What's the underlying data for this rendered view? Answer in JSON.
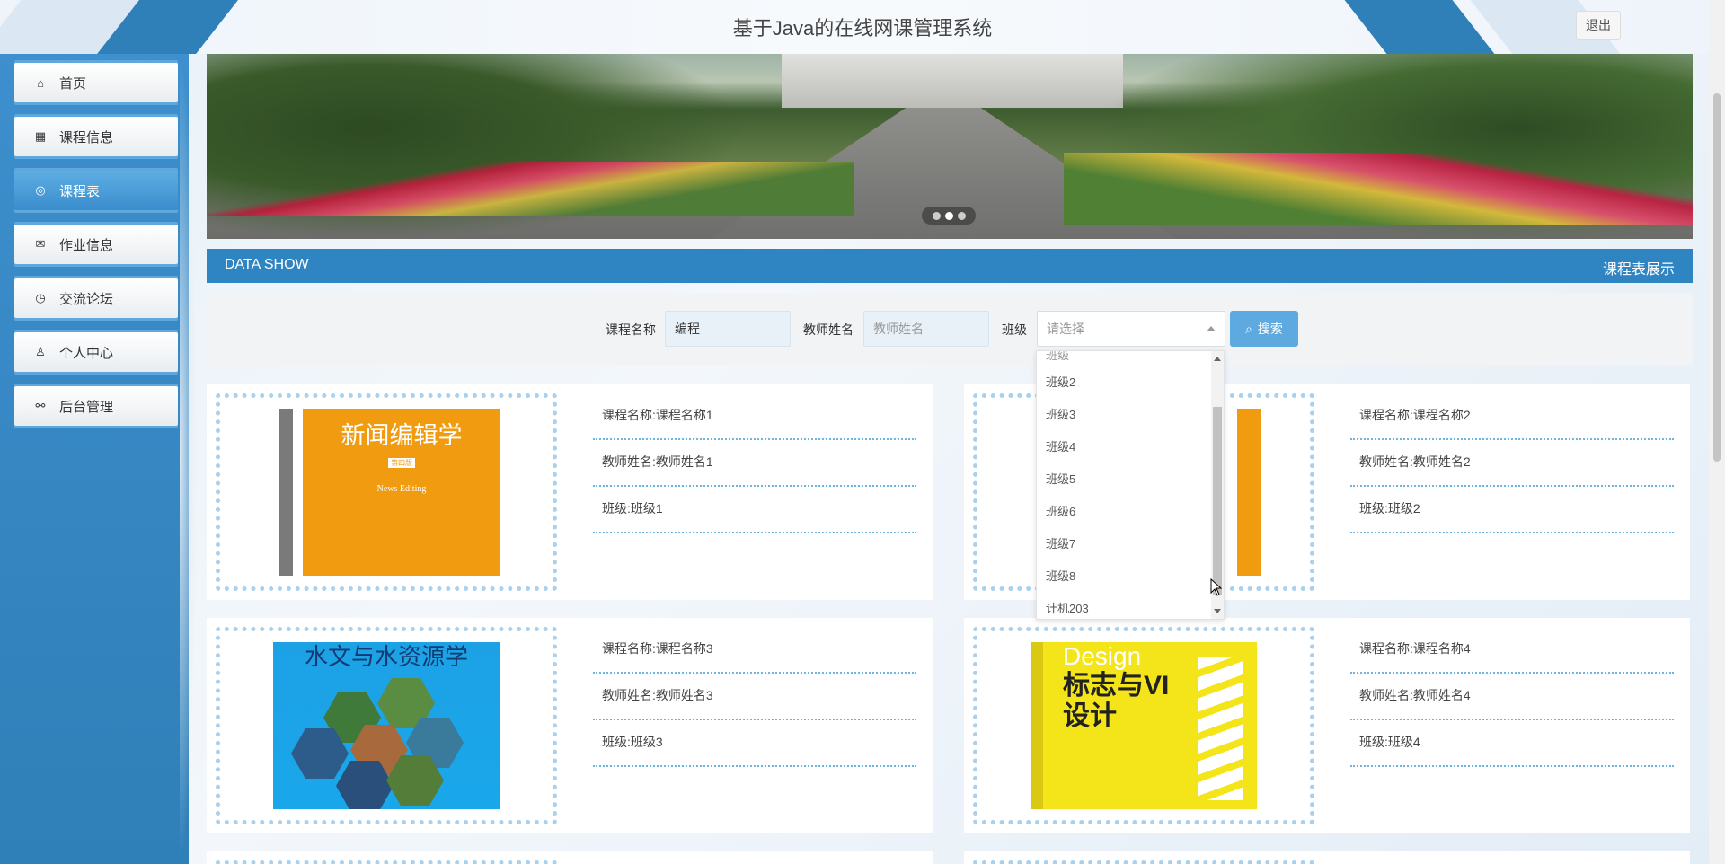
{
  "header": {
    "title": "基于Java的在线网课管理系统",
    "logout_label": "退出"
  },
  "sidebar": {
    "items": [
      {
        "label": "首页",
        "icon": "home-icon"
      },
      {
        "label": "课程信息",
        "icon": "book-icon"
      },
      {
        "label": "课程表",
        "icon": "calendar-icon",
        "active": true
      },
      {
        "label": "作业信息",
        "icon": "mail-icon"
      },
      {
        "label": "交流论坛",
        "icon": "clock-icon"
      },
      {
        "label": "个人中心",
        "icon": "user-icon"
      },
      {
        "label": "后台管理",
        "icon": "link-icon"
      }
    ]
  },
  "banner": {
    "slides": 3,
    "active_slide": 2
  },
  "section": {
    "left_title": "DATA SHOW",
    "right_title": "课程表展示"
  },
  "search": {
    "course_label": "课程名称",
    "course_value": "编程",
    "teacher_label": "教师姓名",
    "teacher_placeholder": "教师姓名",
    "class_label": "班级",
    "class_placeholder": "请选择",
    "button_label": "搜索"
  },
  "dropdown": {
    "options": [
      "班级2",
      "班级3",
      "班级4",
      "班级5",
      "班级6",
      "班级7",
      "班级8",
      "计机203"
    ]
  },
  "cards": [
    {
      "course": "课程名称:课程名称1",
      "teacher": "教师姓名:教师姓名1",
      "class": "班级:班级1",
      "cover_title": "新闻编辑学",
      "cover_subtitle": "News Editing",
      "cover_edition": "第四版"
    },
    {
      "course": "课程名称:课程名称2",
      "teacher": "教师姓名:教师姓名2",
      "class": "班级:班级2"
    },
    {
      "course": "课程名称:课程名称3",
      "teacher": "教师姓名:教师姓名3",
      "class": "班级:班级3",
      "cover_title": "水文与水资源学"
    },
    {
      "course": "课程名称:课程名称4",
      "teacher": "教师姓名:教师姓名4",
      "class": "班级:班级4",
      "cover_title_en": "Design",
      "cover_title": "标志与VI设计"
    }
  ],
  "colors": {
    "primary": "#2f84c2",
    "sidebar": "#3d8fcd",
    "accent_button": "#5ea9df"
  }
}
